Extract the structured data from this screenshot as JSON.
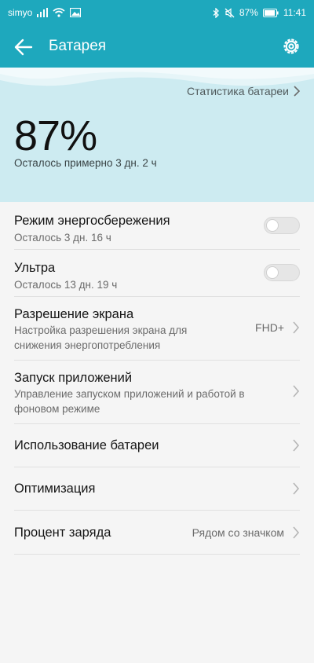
{
  "status_bar": {
    "carrier": "simyo",
    "battery_percent": "87%",
    "time": "11:41",
    "icons": [
      "signal-icon",
      "wifi-icon",
      "gallery-icon",
      "bluetooth-icon",
      "mute-icon",
      "battery-icon"
    ]
  },
  "app_bar": {
    "title": "Батарея",
    "back_icon": "arrow-left-icon",
    "settings_icon": "gear-icon"
  },
  "hero": {
    "stats_link": "Статистика батареи",
    "percent": "87%",
    "remaining": "Осталось примерно 3 дн. 2 ч"
  },
  "settings": {
    "power_saving": {
      "title": "Режим энергосбережения",
      "subtitle": "Осталось 3 дн. 16 ч",
      "enabled": false
    },
    "ultra": {
      "title": "Ультра",
      "subtitle": "Осталось 13 дн. 19 ч",
      "enabled": false
    },
    "resolution": {
      "title": "Разрешение экрана",
      "subtitle_line1": "Настройка разрешения экрана для",
      "subtitle_line2": "снижения энергопотребления",
      "value": "FHD+"
    },
    "app_launch": {
      "title": "Запуск приложений",
      "subtitle_line1": "Управление запуском приложений и работой в",
      "subtitle_line2": "фоновом режиме"
    },
    "battery_usage": {
      "title": "Использование батареи"
    },
    "optimization": {
      "title": "Оптимизация"
    },
    "charge_percent": {
      "title": "Процент заряда",
      "value": "Рядом со значком"
    }
  },
  "colors": {
    "accent": "#1ea8bd",
    "hero_bg": "#cdebf1",
    "page_bg": "#f5f5f5"
  }
}
